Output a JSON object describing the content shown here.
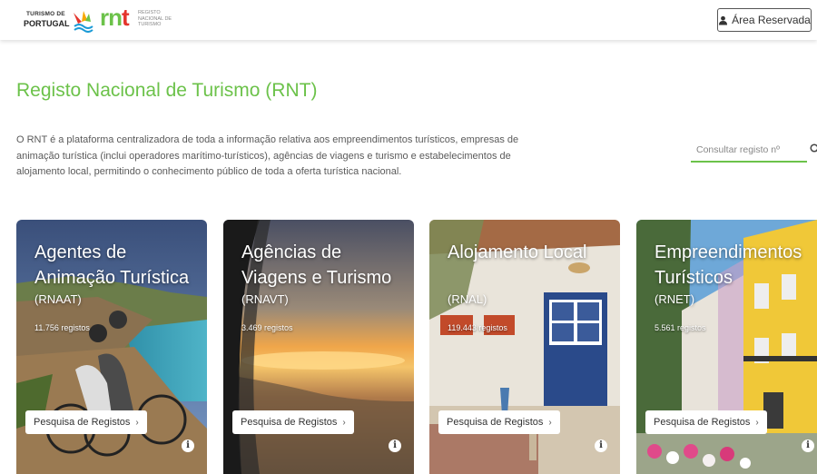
{
  "header": {
    "logo_tp_line1": "TURISMO DE",
    "logo_tp_line2": "PORTUGAL",
    "logo_rnt_mark": "rnt",
    "logo_rnt_sub": "REGISTO NACIONAL DE TURISMO",
    "reserved_area_label": "Área Reservada"
  },
  "page": {
    "title": "Registo Nacional de Turismo (RNT)",
    "description": "O RNT é a plataforma centralizadora de toda a informação relativa aos empreendimentos turísticos, empresas de animação turística (inclui operadores marítimo-turísticos), agências de viagens e turismo e estabelecimentos de alojamento local, permitindo o conhecimento público de toda a oferta turística nacional."
  },
  "search": {
    "placeholder": "Consultar registo nº",
    "icon": "search-icon"
  },
  "cards": [
    {
      "title": "Agentes de Animação Turística",
      "code": "(RNAAT)",
      "count": "11.756 registos",
      "button": "Pesquisa de Registos"
    },
    {
      "title": "Agências de Viagens e Turismo",
      "code": "(RNAVT)",
      "count": "3.469 registos",
      "button": "Pesquisa de Registos"
    },
    {
      "title": "Alojamento Local",
      "code": "(RNAL)",
      "count": "119.443 registos",
      "button": "Pesquisa de Registos"
    },
    {
      "title": "Empreendimentos Turísticos",
      "code": "(RNET)",
      "count": "5.561 registos",
      "button": "Pesquisa de Registos"
    }
  ],
  "colors": {
    "accent": "#6cc24a",
    "rnt_red": "#e4342c"
  }
}
